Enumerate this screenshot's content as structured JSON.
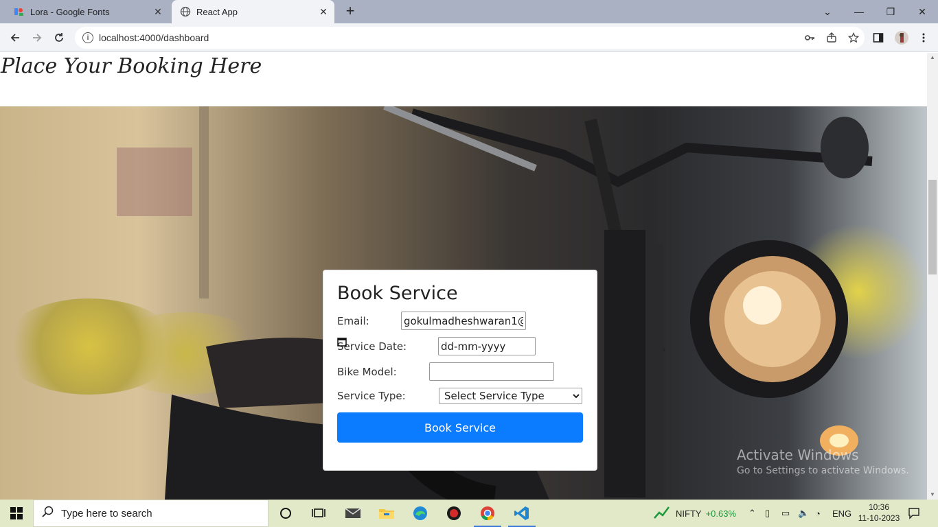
{
  "browser": {
    "tabs": [
      {
        "title": "Lora - Google Fonts",
        "active": false
      },
      {
        "title": "React App",
        "active": true
      }
    ],
    "url": "localhost:4000/dashboard"
  },
  "page": {
    "heading": "Place Your Booking Here",
    "form": {
      "title": "Book Service",
      "email_label": "Email:",
      "email_value": "gokulmadheshwaran1@",
      "date_label": "Service Date:",
      "date_placeholder": "dd-mm-yyyy",
      "bike_label": "Bike Model:",
      "bike_value": "",
      "type_label": "Service Type:",
      "type_selected": "Select Service Type",
      "submit_label": "Book Service"
    }
  },
  "watermark": {
    "line1": "Activate Windows",
    "line2": "Go to Settings to activate Windows."
  },
  "taskbar": {
    "search_placeholder": "Type here to search",
    "nifty_label": "NIFTY",
    "nifty_change": "+0.63%",
    "language": "ENG",
    "time": "10:36",
    "date": "11-10-2023"
  },
  "colors": {
    "accent": "#0b7bff",
    "nifty_green": "#1a9a3a"
  }
}
